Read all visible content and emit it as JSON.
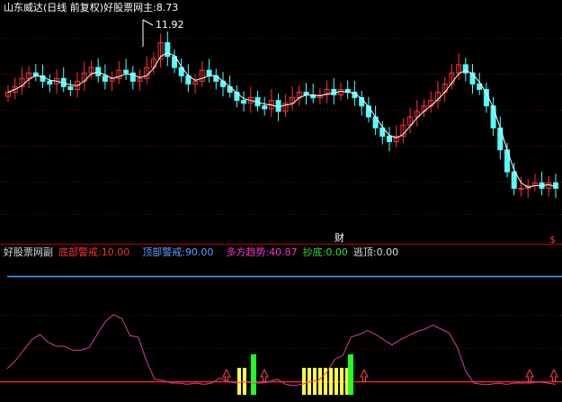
{
  "top_panel": {
    "title": "山东威达(日线 前复权)",
    "indicator_name": "好股票网主",
    "indicator_value": "8.73",
    "peak_label": "11.92",
    "event_marker": "财",
    "dollar_marker": "$"
  },
  "bottom_panel": {
    "title": "好股票网副",
    "items": [
      {
        "label": "底部警戒",
        "value": "10.00",
        "color": "#ff3333"
      },
      {
        "label": "顶部警戒",
        "value": "90.00",
        "color": "#5aa0ff"
      },
      {
        "label": "多方趋势",
        "value": "40.87",
        "color": "#ff33cc"
      },
      {
        "label": "抄底",
        "value": "0.00",
        "color": "#33dd33"
      },
      {
        "label": "逃顶",
        "value": "0.00",
        "color": "#dddddd"
      }
    ]
  },
  "colors": {
    "background": "#000000",
    "up_candle": "#ff3333",
    "down_candle": "#54ffff",
    "ma_line": "#ffffff",
    "grid": "#7a0000",
    "top_line": "#3aa6ff",
    "bottom_line": "#ff2020",
    "trend_line": "#d040a0",
    "yellow_bar": "#ffff40",
    "green_bar": "#20ff20"
  },
  "chart_data": {
    "type": "candlestick",
    "price_series_closes": [
      9.5,
      9.7,
      10.0,
      10.2,
      10.1,
      9.9,
      9.8,
      10.0,
      9.7,
      9.6,
      9.9,
      10.2,
      10.4,
      10.1,
      9.9,
      10.0,
      10.3,
      10.2,
      9.9,
      10.0,
      10.4,
      10.7,
      11.3,
      10.8,
      10.4,
      10.1,
      9.8,
      9.9,
      10.3,
      10.1,
      9.9,
      9.7,
      9.5,
      9.2,
      9.1,
      9.3,
      9.0,
      8.9,
      9.2,
      8.8,
      9.1,
      9.3,
      9.5,
      9.4,
      9.3,
      9.4,
      9.6,
      9.4,
      9.6,
      9.5,
      9.3,
      9.0,
      8.6,
      8.2,
      7.9,
      7.7,
      7.9,
      8.3,
      8.6,
      8.8,
      9.0,
      9.2,
      9.5,
      9.8,
      10.2,
      10.5,
      10.2,
      9.8,
      9.6,
      9.0,
      8.2,
      7.4,
      6.6,
      6.0,
      6.0,
      6.1,
      6.2,
      6.0,
      6.2,
      6.0
    ],
    "price_high": 11.92,
    "last_value": 8.73,
    "oscillator": {
      "bottom_warning": 10.0,
      "top_warning": 90.0,
      "trend_last": 40.87,
      "trend_series": [
        20,
        26,
        34,
        42,
        46,
        40,
        37,
        37,
        34,
        34,
        36,
        46,
        56,
        61,
        58,
        45,
        44,
        26,
        12,
        11,
        9,
        9,
        8,
        9,
        8,
        9,
        13,
        10,
        9,
        10,
        9,
        9,
        10,
        12,
        8,
        7,
        8,
        10,
        11,
        17,
        27,
        30,
        44,
        46,
        49,
        46,
        42,
        38,
        42,
        45,
        48,
        50,
        53,
        50,
        47,
        36,
        18,
        9,
        8,
        8,
        9,
        8,
        9,
        9,
        9,
        10,
        9,
        8
      ],
      "buy_signal": 0.0,
      "sell_signal": 0.0
    }
  }
}
